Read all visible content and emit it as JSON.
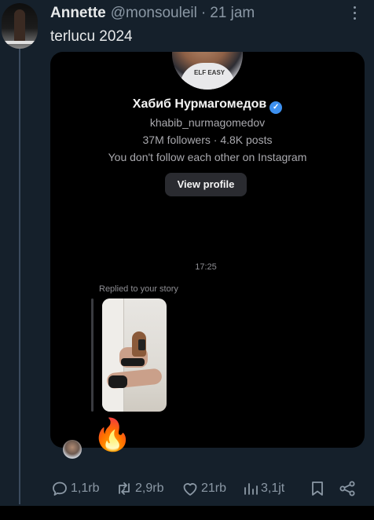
{
  "tweet": {
    "author_name": "Annette",
    "handle": "@monsouleil",
    "separator": "·",
    "time": "21 jam",
    "text": "terlucu 2024"
  },
  "dm_screenshot": {
    "profile_name": "Хабиб Нурмагомедов",
    "verified_icon": "verified-badge-icon",
    "username": "khabib_nurmagomedov",
    "stats": "37M followers · 4.8K posts",
    "follow_status": "You don't follow each other on Instagram",
    "view_profile_label": "View profile",
    "timestamp": "17:25",
    "replied_label": "Replied to your story",
    "reaction": "🔥"
  },
  "actions": {
    "reply_count": "1,1rb",
    "retweet_count": "2,9rb",
    "like_count": "21rb",
    "views_count": "3,1jt"
  },
  "colors": {
    "background": "#15202b",
    "secondary_text": "#8b98a5",
    "verified": "#3d90f0"
  }
}
